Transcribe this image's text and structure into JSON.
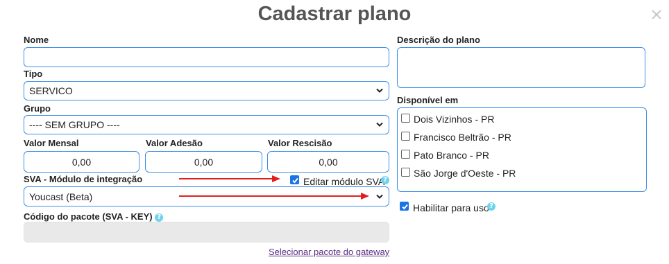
{
  "dialog": {
    "title": "Cadastrar plano"
  },
  "form": {
    "nome_label": "Nome",
    "nome_value": "",
    "tipo_label": "Tipo",
    "tipo_value": "SERVICO",
    "grupo_label": "Grupo",
    "grupo_value": "---- SEM GRUPO ----",
    "valor_mensal_label": "Valor Mensal",
    "valor_mensal_value": "0,00",
    "valor_adesao_label": "Valor Adesão",
    "valor_adesao_value": "0,00",
    "valor_rescisao_label": "Valor Rescisão",
    "valor_rescisao_value": "0,00",
    "sva_label": "SVA - Módulo de integração",
    "editar_sva_label": "Editar módulo SVA",
    "editar_sva_checked": true,
    "sva_value": "Youcast (Beta)",
    "codigo_label": "Código do pacote (SVA - KEY)",
    "codigo_value": "",
    "selecionar_link": "Selecionar pacote do gateway"
  },
  "right": {
    "descricao_label": "Descrição do plano",
    "descricao_value": "",
    "disponivel_label": "Disponível em",
    "cities": [
      {
        "label": "Dois Vizinhos - PR",
        "checked": false
      },
      {
        "label": "Francisco Beltrão - PR",
        "checked": false
      },
      {
        "label": "Pato Branco - PR",
        "checked": false
      },
      {
        "label": "São Jorge d'Oeste - PR",
        "checked": false
      }
    ],
    "habilitar_label": "Habilitar para uso",
    "habilitar_checked": true
  },
  "icons": {
    "help": "?",
    "close": "close-icon",
    "chevron": "chevron-down-icon"
  },
  "colors": {
    "accent_border": "#3b8ee8",
    "checkbox_checked": "#1a73e8",
    "help_icon": "#6fd3ee",
    "annotation_arrow": "#e02020",
    "link": "#5a2d82"
  }
}
